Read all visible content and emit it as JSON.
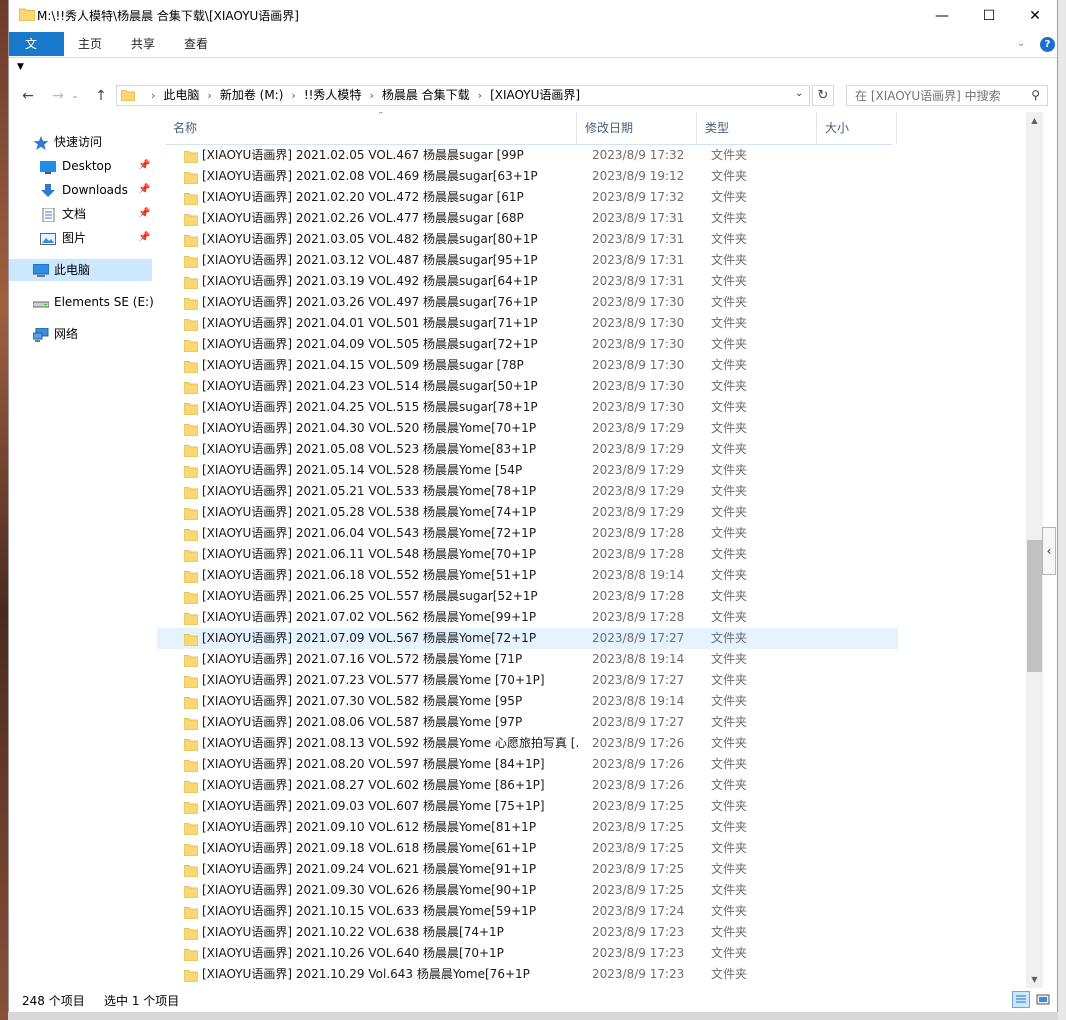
{
  "window": {
    "title": "M:\\!!秀人模特\\杨晨晨 合集下载\\[XIAOYU语画界]",
    "minimize": "—",
    "maximize": "☐",
    "close": "✕"
  },
  "ribbon": {
    "tabs": [
      "文件",
      "主页",
      "共享",
      "查看"
    ],
    "help": "?"
  },
  "address": {
    "crumbs": [
      "此电脑",
      "新加卷 (M:)",
      "!!秀人模特",
      "杨晨晨 合集下载",
      "[XIAOYU语画界]"
    ]
  },
  "search": {
    "placeholder": "在 [XIAOYU语画界] 中搜索"
  },
  "navpane": {
    "quick_access": "快速访问",
    "desktop": "Desktop",
    "downloads": "Downloads",
    "documents": "文档",
    "pictures": "图片",
    "this_pc": "此电脑",
    "elements": "Elements SE (E:)",
    "network": "网络"
  },
  "columns": {
    "name": "名称",
    "date": "修改日期",
    "type": "类型",
    "size": "大小"
  },
  "files": [
    {
      "name": "[XIAOYU语画界] 2021.02.05 VOL.467 杨晨晨sugar [99P",
      "date": "2023/8/9 17:32",
      "type": "文件夹"
    },
    {
      "name": "[XIAOYU语画界] 2021.02.08 VOL.469 杨晨晨sugar[63+1P",
      "date": "2023/8/9 19:12",
      "type": "文件夹"
    },
    {
      "name": "[XIAOYU语画界] 2021.02.20 VOL.472 杨晨晨sugar [61P",
      "date": "2023/8/9 17:32",
      "type": "文件夹"
    },
    {
      "name": "[XIAOYU语画界] 2021.02.26 VOL.477 杨晨晨sugar [68P",
      "date": "2023/8/9 17:31",
      "type": "文件夹"
    },
    {
      "name": "[XIAOYU语画界] 2021.03.05 VOL.482 杨晨晨sugar[80+1P",
      "date": "2023/8/9 17:31",
      "type": "文件夹"
    },
    {
      "name": "[XIAOYU语画界] 2021.03.12 VOL.487 杨晨晨sugar[95+1P",
      "date": "2023/8/9 17:31",
      "type": "文件夹"
    },
    {
      "name": "[XIAOYU语画界] 2021.03.19 VOL.492 杨晨晨sugar[64+1P",
      "date": "2023/8/9 17:31",
      "type": "文件夹"
    },
    {
      "name": "[XIAOYU语画界] 2021.03.26 VOL.497 杨晨晨sugar[76+1P",
      "date": "2023/8/9 17:30",
      "type": "文件夹"
    },
    {
      "name": "[XIAOYU语画界] 2021.04.01 VOL.501 杨晨晨sugar[71+1P",
      "date": "2023/8/9 17:30",
      "type": "文件夹"
    },
    {
      "name": "[XIAOYU语画界] 2021.04.09 VOL.505 杨晨晨sugar[72+1P",
      "date": "2023/8/9 17:30",
      "type": "文件夹"
    },
    {
      "name": "[XIAOYU语画界] 2021.04.15 VOL.509 杨晨晨sugar [78P",
      "date": "2023/8/9 17:30",
      "type": "文件夹"
    },
    {
      "name": "[XIAOYU语画界] 2021.04.23 VOL.514 杨晨晨sugar[50+1P",
      "date": "2023/8/9 17:30",
      "type": "文件夹"
    },
    {
      "name": "[XIAOYU语画界] 2021.04.25 VOL.515 杨晨晨sugar[78+1P",
      "date": "2023/8/9 17:30",
      "type": "文件夹"
    },
    {
      "name": "[XIAOYU语画界] 2021.04.30 VOL.520 杨晨晨Yome[70+1P",
      "date": "2023/8/9 17:29",
      "type": "文件夹"
    },
    {
      "name": "[XIAOYU语画界] 2021.05.08 VOL.523 杨晨晨Yome[83+1P",
      "date": "2023/8/9 17:29",
      "type": "文件夹"
    },
    {
      "name": "[XIAOYU语画界] 2021.05.14 VOL.528 杨晨晨Yome [54P",
      "date": "2023/8/9 17:29",
      "type": "文件夹"
    },
    {
      "name": "[XIAOYU语画界] 2021.05.21 VOL.533 杨晨晨Yome[78+1P",
      "date": "2023/8/9 17:29",
      "type": "文件夹"
    },
    {
      "name": "[XIAOYU语画界] 2021.05.28 VOL.538 杨晨晨Yome[74+1P",
      "date": "2023/8/9 17:29",
      "type": "文件夹"
    },
    {
      "name": "[XIAOYU语画界] 2021.06.04 VOL.543 杨晨晨Yome[72+1P",
      "date": "2023/8/9 17:28",
      "type": "文件夹"
    },
    {
      "name": "[XIAOYU语画界] 2021.06.11 VOL.548 杨晨晨Yome[70+1P",
      "date": "2023/8/9 17:28",
      "type": "文件夹"
    },
    {
      "name": "[XIAOYU语画界] 2021.06.18 VOL.552 杨晨晨Yome[51+1P",
      "date": "2023/8/8 19:14",
      "type": "文件夹"
    },
    {
      "name": "[XIAOYU语画界] 2021.06.25 VOL.557 杨晨晨sugar[52+1P",
      "date": "2023/8/9 17:28",
      "type": "文件夹"
    },
    {
      "name": "[XIAOYU语画界] 2021.07.02 VOL.562 杨晨晨Yome[99+1P",
      "date": "2023/8/9 17:28",
      "type": "文件夹"
    },
    {
      "name": "[XIAOYU语画界] 2021.07.09 VOL.567 杨晨晨Yome[72+1P",
      "date": "2023/8/9 17:27",
      "type": "文件夹"
    },
    {
      "name": "[XIAOYU语画界] 2021.07.16 VOL.572 杨晨晨Yome [71P",
      "date": "2023/8/8 19:14",
      "type": "文件夹"
    },
    {
      "name": "[XIAOYU语画界] 2021.07.23 VOL.577 杨晨晨Yome [70+1P]",
      "date": "2023/8/9 17:27",
      "type": "文件夹"
    },
    {
      "name": "[XIAOYU语画界] 2021.07.30 VOL.582 杨晨晨Yome [95P",
      "date": "2023/8/8 19:14",
      "type": "文件夹"
    },
    {
      "name": "[XIAOYU语画界] 2021.08.06 VOL.587 杨晨晨Yome [97P",
      "date": "2023/8/9 17:27",
      "type": "文件夹"
    },
    {
      "name": "[XIAOYU语画界] 2021.08.13 VOL.592 杨晨晨Yome 心愿旅拍写真 [...",
      "date": "2023/8/9 17:26",
      "type": "文件夹"
    },
    {
      "name": "[XIAOYU语画界] 2021.08.20 VOL.597 杨晨晨Yome [84+1P]",
      "date": "2023/8/9 17:26",
      "type": "文件夹"
    },
    {
      "name": "[XIAOYU语画界] 2021.08.27 VOL.602 杨晨晨Yome [86+1P]",
      "date": "2023/8/9 17:26",
      "type": "文件夹"
    },
    {
      "name": "[XIAOYU语画界] 2021.09.03 VOL.607 杨晨晨Yome [75+1P]",
      "date": "2023/8/9 17:25",
      "type": "文件夹"
    },
    {
      "name": "[XIAOYU语画界] 2021.09.10 VOL.612 杨晨晨Yome[81+1P",
      "date": "2023/8/9 17:25",
      "type": "文件夹"
    },
    {
      "name": "[XIAOYU语画界] 2021.09.18 VOL.618 杨晨晨Yome[61+1P",
      "date": "2023/8/9 17:25",
      "type": "文件夹"
    },
    {
      "name": "[XIAOYU语画界] 2021.09.24 VOL.621 杨晨晨Yome[91+1P",
      "date": "2023/8/9 17:25",
      "type": "文件夹"
    },
    {
      "name": "[XIAOYU语画界] 2021.09.30 VOL.626 杨晨晨Yome[90+1P",
      "date": "2023/8/9 17:25",
      "type": "文件夹"
    },
    {
      "name": "[XIAOYU语画界] 2021.10.15 VOL.633 杨晨晨Yome[59+1P",
      "date": "2023/8/9 17:24",
      "type": "文件夹"
    },
    {
      "name": "[XIAOYU语画界] 2021.10.22 VOL.638 杨晨晨[74+1P",
      "date": "2023/8/9 17:23",
      "type": "文件夹"
    },
    {
      "name": "[XIAOYU语画界] 2021.10.26 VOL.640 杨晨晨[70+1P",
      "date": "2023/8/9 17:23",
      "type": "文件夹"
    },
    {
      "name": "[XIAOYU语画界] 2021.10.29 Vol.643 杨晨晨Yome[76+1P",
      "date": "2023/8/9 17:23",
      "type": "文件夹"
    }
  ],
  "selected_index": 23,
  "status": {
    "count": "248 个项目",
    "selected": "选中 1 个项目"
  },
  "colors": {
    "accent": "#1979ca",
    "folder": "#f8d775",
    "selected_row": "#e5f3ff"
  }
}
